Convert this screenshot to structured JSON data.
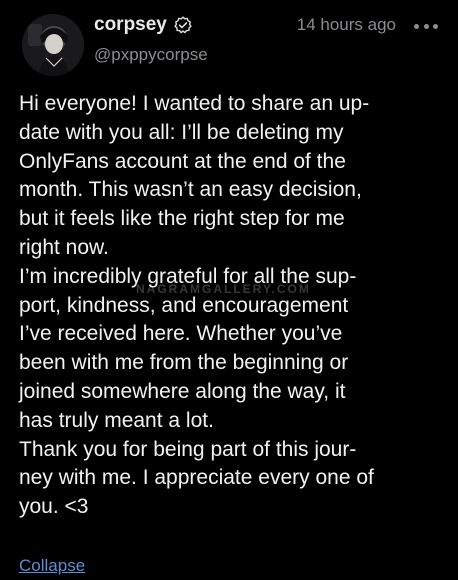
{
  "post": {
    "display_name": "corpsey",
    "handle": "@pxppycorpse",
    "timestamp": "14 hours ago",
    "body_lines": [
      "Hi everyone! I wanted to share an up-",
      "date with you all: I’ll be deleting my",
      "OnlyFans account at the end of the",
      "month. This wasn’t an easy decision,",
      "but it feels like the right step for me",
      "right now.",
      "I’m incredibly grateful for all the sup-",
      "port, kindness, and encouragement",
      "I’ve received here. Whether you’ve",
      "been with me from the beginning or",
      "joined somewhere along the way, it",
      "has truly meant a lot.",
      "Thank you for being part of this jour-",
      "ney with me. I appreciate every one of",
      "you. <3"
    ],
    "collapse_label": "Collapse",
    "watermark_text": "NAGRAMGALLERY.COM"
  },
  "icons": {
    "verified": "verified-badge-icon",
    "more": "more-options-icon"
  },
  "colors": {
    "background": "#000000",
    "text": "#f2f2f2",
    "muted": "#8c8c91",
    "link": "#5b8fd6"
  }
}
